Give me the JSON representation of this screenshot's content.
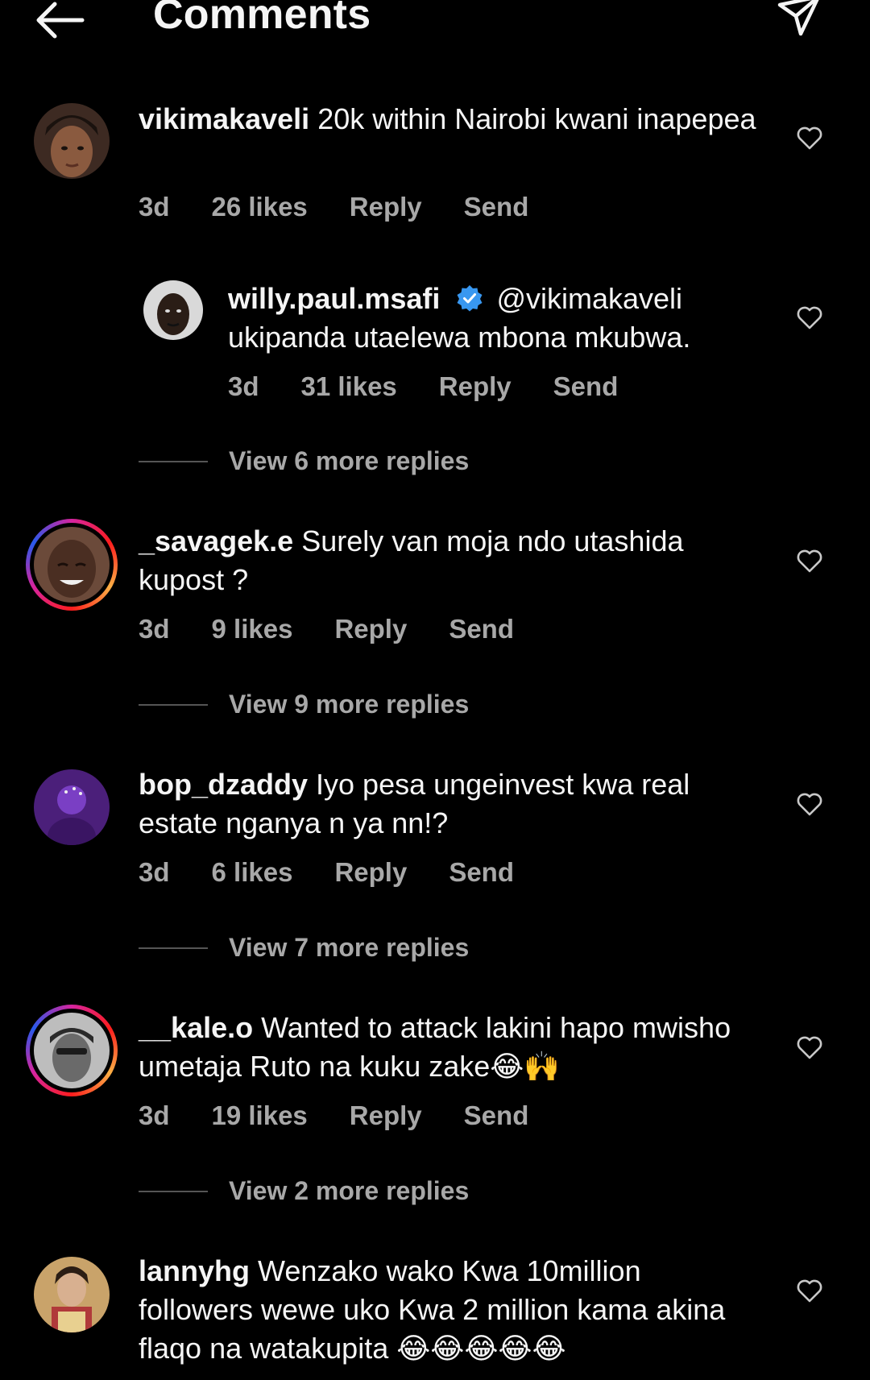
{
  "header": {
    "title": "Comments"
  },
  "comments": [
    {
      "username": "vikimakaveli",
      "text": "20k within Nairobi kwani inapepea",
      "time": "3d",
      "likes": "26 likes",
      "reply": "Reply",
      "send": "Send"
    },
    {
      "username": "willy.paul.msafi",
      "mention": "@vikimakaveli",
      "text": "ukipanda utaelewa mbona mkubwa.",
      "time": "3d",
      "likes": "31 likes",
      "reply": "Reply",
      "send": "Send"
    },
    {
      "view_more": "View 6 more replies"
    },
    {
      "username": "_savagek.e",
      "text": "Surely van moja ndo utashida kupost ?",
      "time": "3d",
      "likes": "9 likes",
      "reply": "Reply",
      "send": "Send",
      "view_more": "View 9 more replies"
    },
    {
      "username": "bop_dzaddy",
      "text": "Iyo pesa ungeinvest kwa real estate nganya n ya nn!?",
      "time": "3d",
      "likes": "6 likes",
      "reply": "Reply",
      "send": "Send",
      "view_more": "View 7 more replies"
    },
    {
      "username": "__kale.o",
      "text": "Wanted to attack lakini hapo mwisho umetaja Ruto na kuku zake😂🙌",
      "time": "3d",
      "likes": "19 likes",
      "reply": "Reply",
      "send": "Send",
      "view_more": "View 2 more replies"
    },
    {
      "username": "lannyhg",
      "text": "Wenzako wako Kwa 10million followers wewe uko Kwa 2 million kama akina flaqo na watakupita 😂😂😂😂😂"
    }
  ],
  "colors": {
    "background": "#000000",
    "text": "#f5f5f5",
    "muted": "#a8a8a8",
    "verified": "#3897f0"
  },
  "icons": [
    "arrow-left-icon",
    "paper-plane-icon",
    "heart-outline-icon",
    "verified-badge-icon"
  ]
}
